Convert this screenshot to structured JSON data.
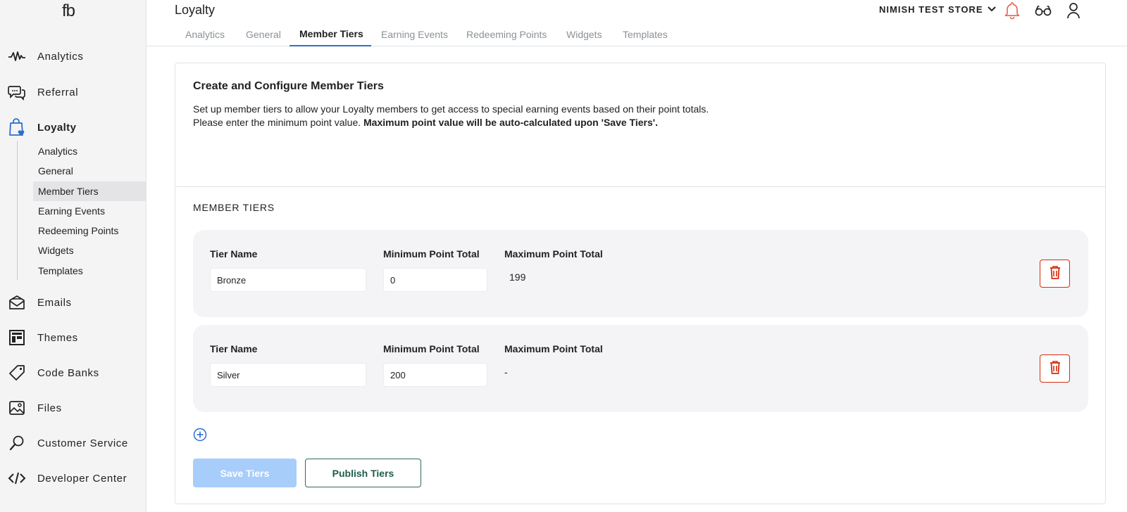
{
  "brand": {
    "logo_text": "fb"
  },
  "sidebar": {
    "items": [
      {
        "label": "Analytics",
        "icon": "pulse-icon"
      },
      {
        "label": "Referral",
        "icon": "chat-bubbles-icon"
      },
      {
        "label": "Loyalty",
        "icon": "shopping-bag-heart-icon",
        "active": true
      },
      {
        "label": "Emails",
        "icon": "mail-icon"
      },
      {
        "label": "Themes",
        "icon": "layout-icon"
      },
      {
        "label": "Code Banks",
        "icon": "tag-icon"
      },
      {
        "label": "Files",
        "icon": "image-icon"
      },
      {
        "label": "Customer Service",
        "icon": "magnifier-icon"
      },
      {
        "label": "Developer Center",
        "icon": "code-icon"
      }
    ],
    "loyalty_subitems": [
      {
        "label": "Analytics"
      },
      {
        "label": "General"
      },
      {
        "label": "Member Tiers",
        "active": true
      },
      {
        "label": "Earning Events"
      },
      {
        "label": "Redeeming Points"
      },
      {
        "label": "Widgets"
      },
      {
        "label": "Templates"
      }
    ]
  },
  "header": {
    "title": "Loyalty",
    "store_name": "NIMISH TEST STORE",
    "icons": [
      "bell-icon",
      "glasses-icon",
      "user-icon"
    ]
  },
  "tabs": [
    {
      "label": "Analytics"
    },
    {
      "label": "General"
    },
    {
      "label": "Member Tiers",
      "active": true
    },
    {
      "label": "Earning Events"
    },
    {
      "label": "Redeeming Points"
    },
    {
      "label": "Widgets"
    },
    {
      "label": "Templates"
    }
  ],
  "card": {
    "title": "Create and Configure Member Tiers",
    "desc_line1": "Set up member tiers to allow your Loyalty members to get access to special earning events based on their point totals.",
    "desc_line2_plain": "Please enter the minimum point value. ",
    "desc_line2_bold": "Maximum point value will be auto-calculated upon 'Save Tiers'."
  },
  "tiers_section": {
    "label": "MEMBER TIERS",
    "col_name": "Tier Name",
    "col_min": "Minimum Point Total",
    "col_max": "Maximum Point Total",
    "tiers": [
      {
        "name": "Bronze",
        "min": "0",
        "max": "199"
      },
      {
        "name": "Silver",
        "min": "200",
        "max": "-"
      }
    ]
  },
  "actions": {
    "save_label": "Save Tiers",
    "publish_label": "Publish Tiers"
  },
  "colors": {
    "accent": "#2c6ecb",
    "danger": "#d72c0d",
    "save_disabled": "#a7cdfb",
    "publish_border": "#2f6b5c",
    "bell": "#e9634e"
  }
}
